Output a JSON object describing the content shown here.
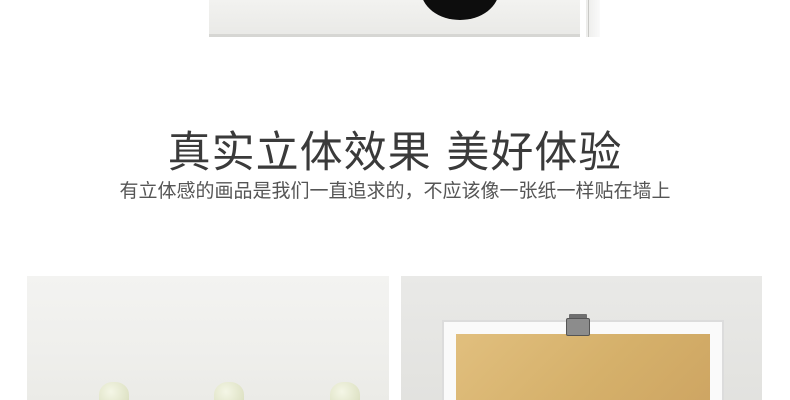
{
  "headline": "真实立体效果 美好体验",
  "subline": "有立体感的画品是我们一直追求的，不应该像一张纸一样贴在墙上"
}
